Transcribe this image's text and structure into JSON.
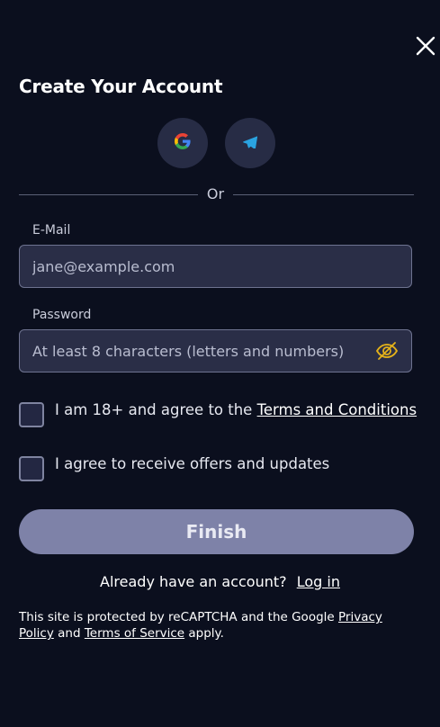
{
  "dialog": {
    "title": "Create Your Account"
  },
  "social": {
    "google_icon": "google-icon",
    "telegram_icon": "telegram-icon"
  },
  "divider": {
    "text": "Or"
  },
  "email": {
    "label": "E-Mail",
    "placeholder": "jane@example.com",
    "value": ""
  },
  "password": {
    "label": "Password",
    "placeholder": "At least 8 characters (letters and numbers)",
    "value": ""
  },
  "terms": {
    "checked": false,
    "text": "I am 18+ and agree to the",
    "link": "Terms and Conditions"
  },
  "offers": {
    "checked": false,
    "text": "I agree to receive offers and updates"
  },
  "finish_button": {
    "label": "Finish"
  },
  "login": {
    "text": "Already have an account?",
    "link": "Log in"
  },
  "recaptcha": {
    "text_1": "This site is protected by reCAPTCHA and the Google",
    "privacy_link": "Privacy Policy",
    "text_2": "and",
    "terms_link": "Terms of Service",
    "text_3": "apply."
  },
  "colors": {
    "background": "#0b0f1e",
    "input_background": "#2a2e47",
    "button_disabled": "#7e82a8",
    "telegram_blue": "#2aa3e0",
    "eye_icon": "#e4b21a"
  }
}
